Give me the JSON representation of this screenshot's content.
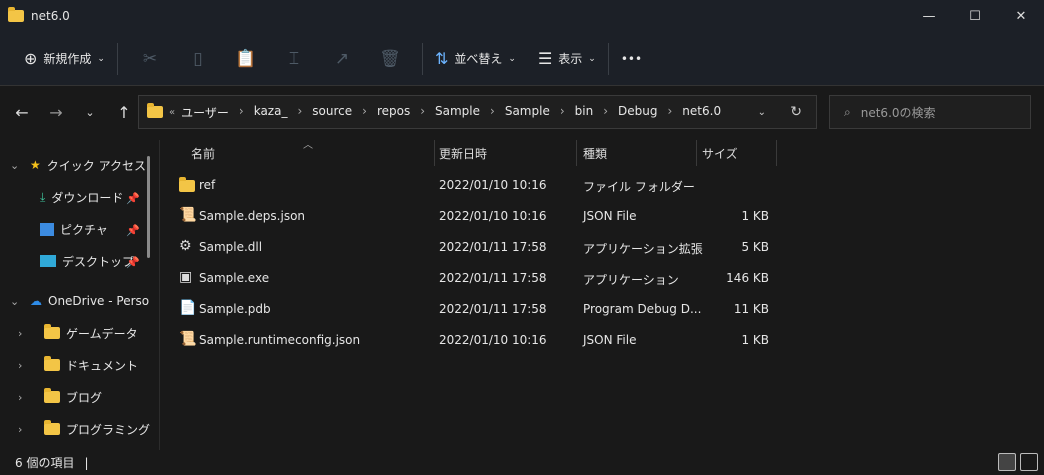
{
  "window": {
    "title": "net6.0",
    "minimize": "—",
    "maximize": "☐",
    "close": "✕"
  },
  "toolbar": {
    "new_label": "新規作成",
    "sort_label": "並べ替え",
    "view_label": "表示",
    "more": "•••"
  },
  "address": {
    "overflow": "«",
    "crumbs": [
      "ユーザー",
      "kaza_",
      "source",
      "repos",
      "Sample",
      "Sample",
      "bin",
      "Debug",
      "net6.0"
    ]
  },
  "search": {
    "placeholder": "net6.0の検索"
  },
  "sidebar": {
    "quick_access": "クイック アクセス",
    "pinned": [
      "ダウンロード",
      "ピクチャ",
      "デスクトップ"
    ],
    "onedrive": "OneDrive - Perso",
    "folders": [
      "ゲームデータ",
      "ドキュメント",
      "ブログ",
      "プログラミング"
    ]
  },
  "columns": {
    "name": "名前",
    "date": "更新日時",
    "type": "種類",
    "size": "サイズ"
  },
  "files": [
    {
      "name": "ref",
      "date": "2022/01/10 10:16",
      "type": "ファイル フォルダー",
      "size": "",
      "icon": "folder-icon"
    },
    {
      "name": "Sample.deps.json",
      "date": "2022/01/10 10:16",
      "type": "JSON File",
      "size": "1 KB",
      "icon": "json-file-icon"
    },
    {
      "name": "Sample.dll",
      "date": "2022/01/11 17:58",
      "type": "アプリケーション拡張",
      "size": "5 KB",
      "icon": "dll-file-icon"
    },
    {
      "name": "Sample.exe",
      "date": "2022/01/11 17:58",
      "type": "アプリケーション",
      "size": "146 KB",
      "icon": "exe-file-icon"
    },
    {
      "name": "Sample.pdb",
      "date": "2022/01/11 17:58",
      "type": "Program Debug D...",
      "size": "11 KB",
      "icon": "pdb-file-icon"
    },
    {
      "name": "Sample.runtimeconfig.json",
      "date": "2022/01/10 10:16",
      "type": "JSON File",
      "size": "1 KB",
      "icon": "json-file-icon"
    }
  ],
  "status": {
    "count": "6 個の項目"
  }
}
